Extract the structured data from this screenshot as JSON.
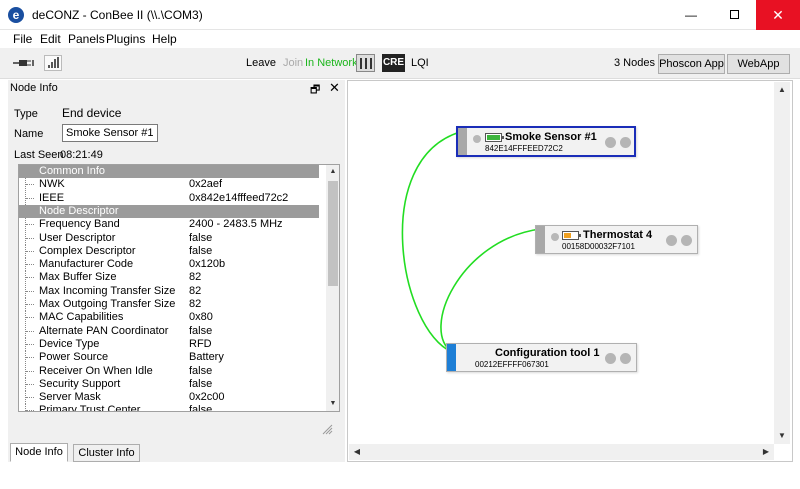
{
  "window": {
    "title": "deCONZ - ConBee II (\\\\.\\COM3)",
    "app_icon_glyph": "e",
    "minimize_glyph": "—",
    "close_glyph": "✕"
  },
  "menubar": {
    "items": [
      "File",
      "Edit",
      "Panels",
      "Plugins",
      "Help"
    ]
  },
  "toolbar": {
    "leave": "Leave",
    "join": "Join",
    "in_network": "In Network",
    "cre": "CRE",
    "lqi": "LQI",
    "node_count": "3 Nodes",
    "phoscon_app": "Phoscon App",
    "webapp": "WebApp"
  },
  "node_info": {
    "panel_title": "Node Info",
    "float_glyph": "🗗",
    "close_glyph": "✕",
    "type_label": "Type",
    "type_value": "End device",
    "name_label": "Name",
    "name_value": "Smoke Sensor #1",
    "last_seen_label": "Last Seen",
    "last_seen_value": "08:21:49",
    "sections": [
      {
        "title": "Common Info",
        "rows": [
          {
            "k": "NWK",
            "v": "0x2aef"
          },
          {
            "k": "IEEE",
            "v": "0x842e14fffeed72c2"
          }
        ]
      },
      {
        "title": "Node Descriptor",
        "rows": [
          {
            "k": "Frequency Band",
            "v": "2400 - 2483.5 MHz"
          },
          {
            "k": "User Descriptor",
            "v": "false"
          },
          {
            "k": "Complex Descriptor",
            "v": "false"
          },
          {
            "k": "Manufacturer Code",
            "v": "0x120b"
          },
          {
            "k": "Max Buffer Size",
            "v": "82"
          },
          {
            "k": "Max Incoming Transfer Size",
            "v": "82"
          },
          {
            "k": "Max Outgoing Transfer Size",
            "v": "82"
          },
          {
            "k": "MAC Capabilities",
            "v": "0x80"
          },
          {
            "k": "Alternate PAN Coordinator",
            "v": "false"
          },
          {
            "k": "Device Type",
            "v": "RFD"
          },
          {
            "k": "Power Source",
            "v": "Battery"
          },
          {
            "k": "Receiver On When Idle",
            "v": "false"
          },
          {
            "k": "Security Support",
            "v": "false"
          },
          {
            "k": "Server Mask",
            "v": "0x2c00"
          },
          {
            "k": "Primary Trust Center",
            "v": "false"
          }
        ]
      }
    ],
    "tabs": [
      "Node Info",
      "Cluster Info"
    ]
  },
  "graph": {
    "nodes": [
      {
        "name": "Smoke Sensor #1",
        "mac": "842E14FFFEED72C2",
        "battery_color": "#3cb43c",
        "battery_level": 1.0,
        "selected": true
      },
      {
        "name": "Thermostat 4",
        "mac": "00158D00032F7101",
        "battery_color": "#f0a020",
        "battery_level": 0.5,
        "selected": false
      },
      {
        "name": "Configuration tool 1",
        "mac": "00212EFFFF067301",
        "selected": false
      }
    ],
    "link_color": "#22dd22"
  }
}
